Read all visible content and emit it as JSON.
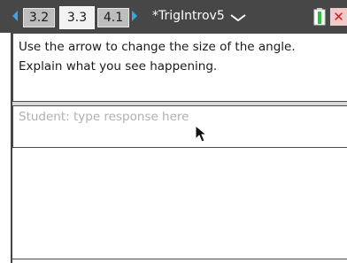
{
  "tabs": [
    {
      "label": "3.2",
      "active": false
    },
    {
      "label": "3.3",
      "active": true
    },
    {
      "label": "4.1",
      "active": false
    }
  ],
  "document": {
    "title": "*TrigIntrov5"
  },
  "icons": {
    "nav_left": "chevron-left-icon",
    "nav_right": "chevron-right-icon",
    "menu": "chevron-down-icon",
    "battery": "battery-icon",
    "close": "close-icon",
    "cursor": "mouse-pointer-icon"
  },
  "close_symbol": "✕",
  "question": {
    "line1": "Use the arrow to change the size of the angle.",
    "line2": "Explain what you see happening."
  },
  "response": {
    "placeholder": "Student: type response here",
    "value": ""
  },
  "colors": {
    "toolbar": "#474747",
    "accent": "#3aa6e0",
    "battery_green": "#2fbf3a",
    "close_red": "#d01b1b"
  }
}
